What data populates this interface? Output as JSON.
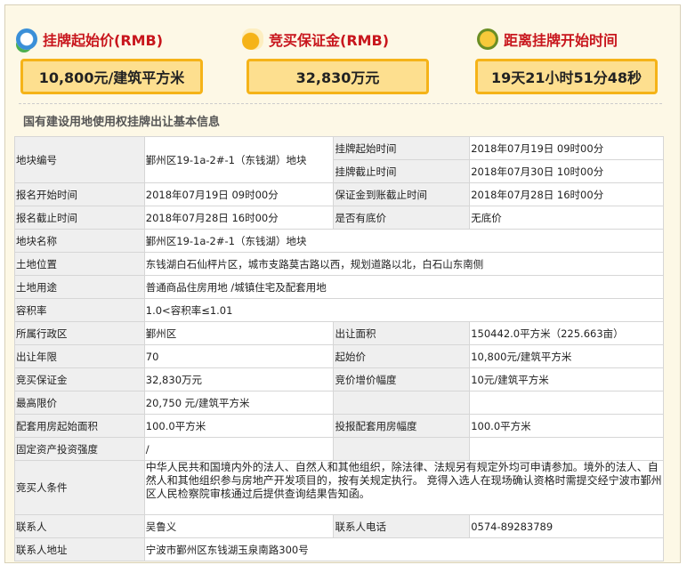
{
  "summary": [
    {
      "title": "挂牌起始价(RMB)",
      "value": "10,800元/建筑平方米",
      "icon": "clock-money-icon"
    },
    {
      "title": "竞买保证金(RMB)",
      "value": "32,830万元",
      "icon": "money-bag-icon"
    },
    {
      "title": "距离挂牌开始时间",
      "value": "19天21小时51分48秒",
      "icon": "alarm-clock-icon"
    }
  ],
  "section_title": "国有建设用地使用权挂牌出让基本信息",
  "rows": {
    "plot_no": {
      "label": "地块编号",
      "value": "鄞州区19-1a-2#-1（东钱湖）地块"
    },
    "list_start": {
      "label": "挂牌起始时间",
      "value": "2018年07月19日 09时00分"
    },
    "list_end": {
      "label": "挂牌截止时间",
      "value": "2018年07月30日 10时00分"
    },
    "reg_start": {
      "label": "报名开始时间",
      "value": "2018年07月19日 09时00分"
    },
    "deposit_deadline": {
      "label": "保证金到账截止时间",
      "value": "2018年07月28日 16时00分"
    },
    "reg_end": {
      "label": "报名截止时间",
      "value": "2018年07月28日 16时00分"
    },
    "reserve": {
      "label": "是否有底价",
      "value": "无底价"
    },
    "plot_name": {
      "label": "地块名称",
      "value": "鄞州区19-1a-2#-1（东钱湖）地块"
    },
    "location": {
      "label": "土地位置",
      "value": "东钱湖白石仙枰片区，城市支路莫古路以西，规划道路以北，白石山东南侧"
    },
    "usage": {
      "label": "土地用途",
      "value": "普通商品住房用地 /城镇住宅及配套用地"
    },
    "far": {
      "label": "容积率",
      "value": "1.0<容积率≤1.01"
    },
    "district": {
      "label": "所属行政区",
      "value": "鄞州区"
    },
    "area": {
      "label": "出让面积",
      "value": "150442.0平方米（225.663亩）"
    },
    "term": {
      "label": "出让年限",
      "value": "70"
    },
    "start_price": {
      "label": "起始价",
      "value": "10,800元/建筑平方米"
    },
    "deposit": {
      "label": "竞买保证金",
      "value": "32,830万元"
    },
    "increment": {
      "label": "竞价增价幅度",
      "value": "10元/建筑平方米"
    },
    "max_price": {
      "label": "最高限价",
      "value": "20,750 元/建筑平方米"
    },
    "housing_start": {
      "label": "配套用房起始面积",
      "value": "100.0平方米"
    },
    "housing_step": {
      "label": "投报配套用房幅度",
      "value": "100.0平方米"
    },
    "investment": {
      "label": "固定资产投资强度",
      "value": "/"
    },
    "conditions": {
      "label": "竞买人条件",
      "value": "中华人民共和国境内外的法人、自然人和其他组织，除法律、法规另有规定外均可申请参加。境外的法人、自然人和其他组织参与房地产开发项目的，按有关规定执行。 竞得入选人在现场确认资格时需提交经宁波市鄞州区人民检察院审核通过后提供查询结果告知函。"
    },
    "contact": {
      "label": "联系人",
      "value": "吴鲁义"
    },
    "phone": {
      "label": "联系人电话",
      "value": "0574-89283789"
    },
    "address": {
      "label": "联系人地址",
      "value": "宁波市鄞州区东钱湖玉泉南路300号"
    }
  }
}
